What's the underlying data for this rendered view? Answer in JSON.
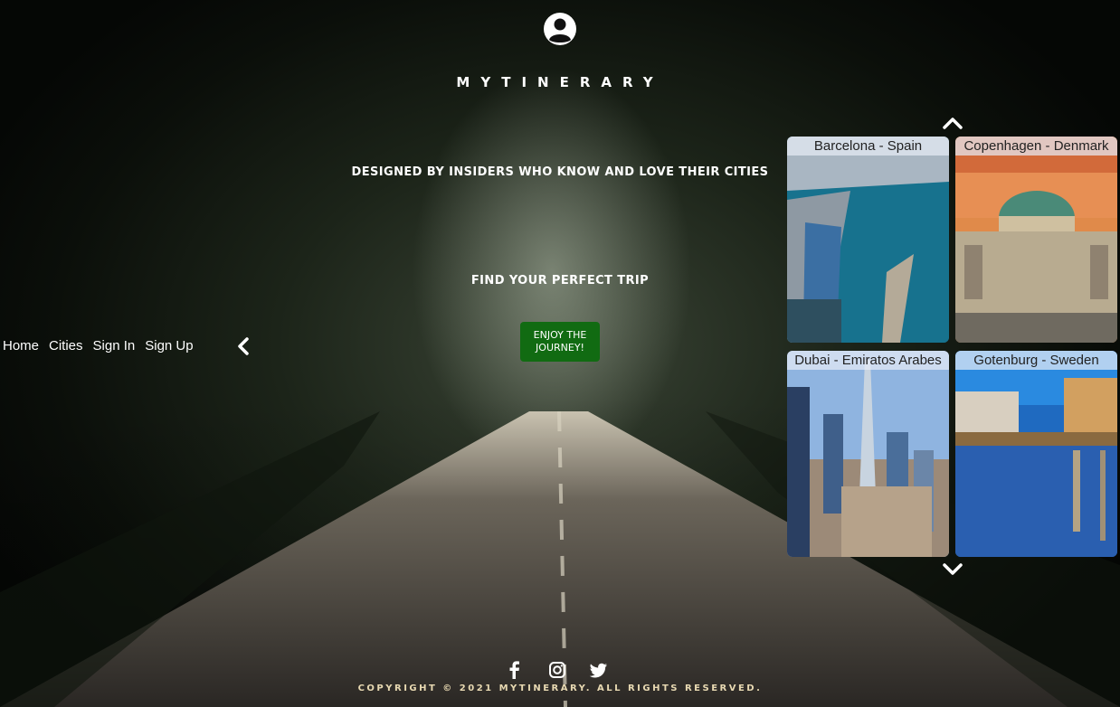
{
  "brand": "MYTINERARY",
  "tagline": "DESIGNED BY INSIDERS WHO KNOW AND LOVE THEIR CITIES",
  "subtitle": "FIND YOUR PERFECT TRIP",
  "cta_label": "ENJOY THE JOURNEY!",
  "nav": {
    "items": [
      {
        "label": "Home"
      },
      {
        "label": "Cities"
      },
      {
        "label": "Sign In"
      },
      {
        "label": "Sign Up"
      }
    ],
    "collapse_icon": "chevron-left-icon"
  },
  "carousel": {
    "up_icon": "chevron-up-icon",
    "down_icon": "chevron-down-icon",
    "cards": [
      {
        "label": "Barcelona - Spain"
      },
      {
        "label": "Copenhagen - Denmark"
      },
      {
        "label": "Dubai - Emiratos Arabes"
      },
      {
        "label": "Gotenburg - Sweden"
      }
    ]
  },
  "footer": {
    "icons": [
      "facebook-icon",
      "instagram-icon",
      "twitter-icon"
    ],
    "copyright": "COPYRIGHT © 2021 MYTINERARY. ALL RIGHTS RESERVED."
  },
  "colors": {
    "cta_bg": "#116b12",
    "copyright": "#e8d9b2"
  }
}
